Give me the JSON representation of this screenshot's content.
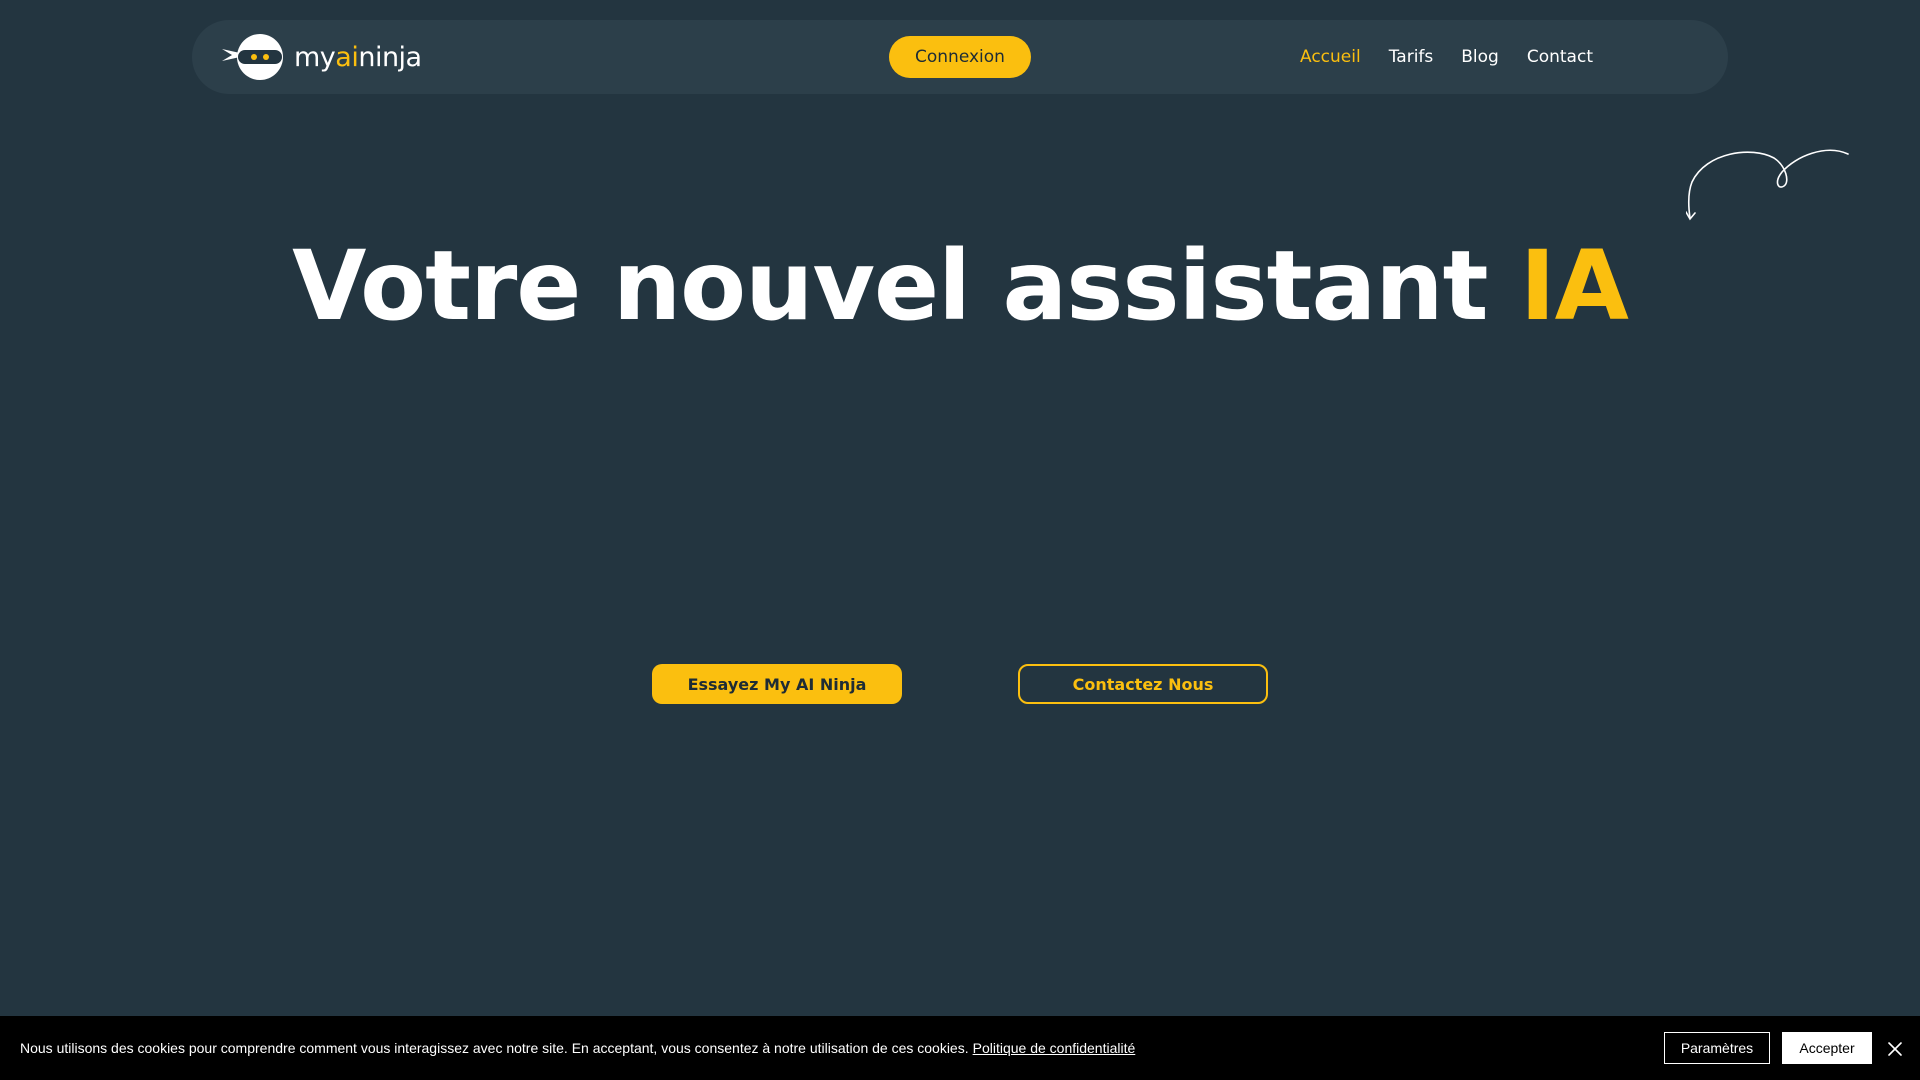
{
  "header": {
    "logo": {
      "text_prefix": "my",
      "text_accent": "ai",
      "text_suffix": "ninja",
      "icon": "ninja-head-icon"
    },
    "login_label": "Connexion",
    "nav": [
      {
        "label": "Accueil",
        "active": true
      },
      {
        "label": "Tarifs",
        "active": false
      },
      {
        "label": "Blog",
        "active": false
      },
      {
        "label": "Contact",
        "active": false
      }
    ]
  },
  "hero": {
    "title_main": "Votre nouvel assistant",
    "title_accent": "IA",
    "decoration_icon": "curved-arrow-icon",
    "primary_cta": "Essayez My AI Ninja",
    "secondary_cta": "Contactez Nous"
  },
  "cookie_bar": {
    "message": "Nous utilisons des cookies pour comprendre comment vous interagissez avec notre site. En acceptant, vous consentez à notre utilisation de ces cookies.",
    "policy_link": "Politique de confidentialité",
    "settings_label": "Paramètres",
    "accept_label": "Accepter",
    "close_icon": "close-icon"
  },
  "colors": {
    "background": "#233540",
    "navbar": "#2c3f4a",
    "accent": "#fbbf0f",
    "text": "#ffffff",
    "cookie_bar": "#000000"
  }
}
